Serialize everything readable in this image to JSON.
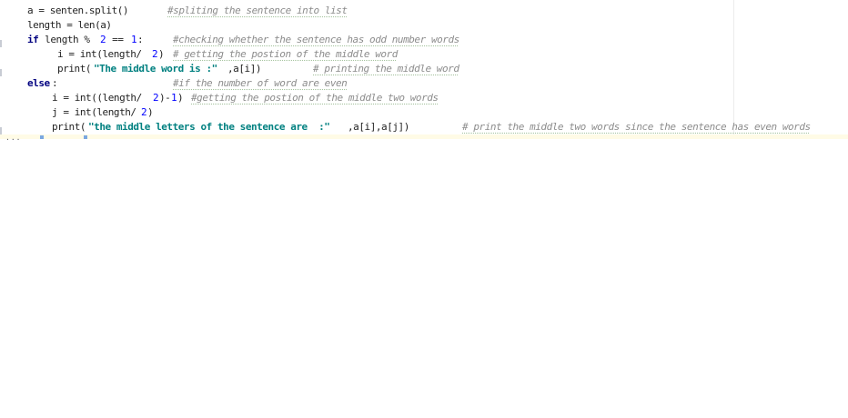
{
  "editor": {
    "lines": [
      {
        "segments": [
          {
            "text": "a = senten.split()",
            "kind": "plain"
          },
          {
            "text": "#spliting the sentence into list",
            "kind": "comment"
          }
        ]
      },
      {
        "segments": [
          {
            "text": "length = len(a)",
            "kind": "plain"
          }
        ]
      },
      {
        "segments": [
          {
            "text": "if",
            "kind": "keyword"
          },
          {
            "text": " length % ",
            "kind": "plain"
          },
          {
            "text": "2",
            "kind": "number"
          },
          {
            "text": " == ",
            "kind": "plain"
          },
          {
            "text": "1",
            "kind": "number"
          },
          {
            "text": ":",
            "kind": "plain"
          },
          {
            "text": "#checking whether the sentence has odd number words",
            "kind": "comment"
          }
        ]
      },
      {
        "segments": [
          {
            "text": "i = int(length/",
            "kind": "plain"
          },
          {
            "text": "2",
            "kind": "number"
          },
          {
            "text": ")",
            "kind": "plain"
          },
          {
            "text": "# getting the postion of the middle word",
            "kind": "comment"
          }
        ]
      },
      {
        "segments": [
          {
            "text": "print(",
            "kind": "plain"
          },
          {
            "text": "\"The middle word is :\"",
            "kind": "string"
          },
          {
            "text": ",a[i])",
            "kind": "plain"
          },
          {
            "text": "# printing the middle word",
            "kind": "comment"
          }
        ]
      },
      {
        "segments": [
          {
            "text": "else",
            "kind": "keyword"
          },
          {
            "text": ":",
            "kind": "plain"
          },
          {
            "text": "#if the number of word are even",
            "kind": "comment"
          }
        ]
      },
      {
        "segments": [
          {
            "text": "i = int((length/",
            "kind": "plain"
          },
          {
            "text": "2",
            "kind": "number"
          },
          {
            "text": ")-",
            "kind": "plain"
          },
          {
            "text": "1",
            "kind": "number"
          },
          {
            "text": ")",
            "kind": "plain"
          },
          {
            "text": "#getting the postion of the middle two words",
            "kind": "comment"
          }
        ]
      },
      {
        "segments": [
          {
            "text": "j = int(length/",
            "kind": "plain"
          },
          {
            "text": "2",
            "kind": "number"
          },
          {
            "text": ")",
            "kind": "plain"
          }
        ]
      },
      {
        "segments": [
          {
            "text": "print(",
            "kind": "plain"
          },
          {
            "text": "\"the middle letters of the sentence are  :\"",
            "kind": "string"
          },
          {
            "text": ",a[i],a[j])",
            "kind": "plain"
          },
          {
            "text": "# print the middle two words since the sentence has even words",
            "kind": "comment"
          }
        ]
      }
    ],
    "fold_marker": "...",
    "colors": {
      "keyword": "#000080",
      "number": "#0000ff",
      "string": "#008080",
      "comment": "#8c8c8c",
      "current_line": "#fffbe6"
    }
  }
}
